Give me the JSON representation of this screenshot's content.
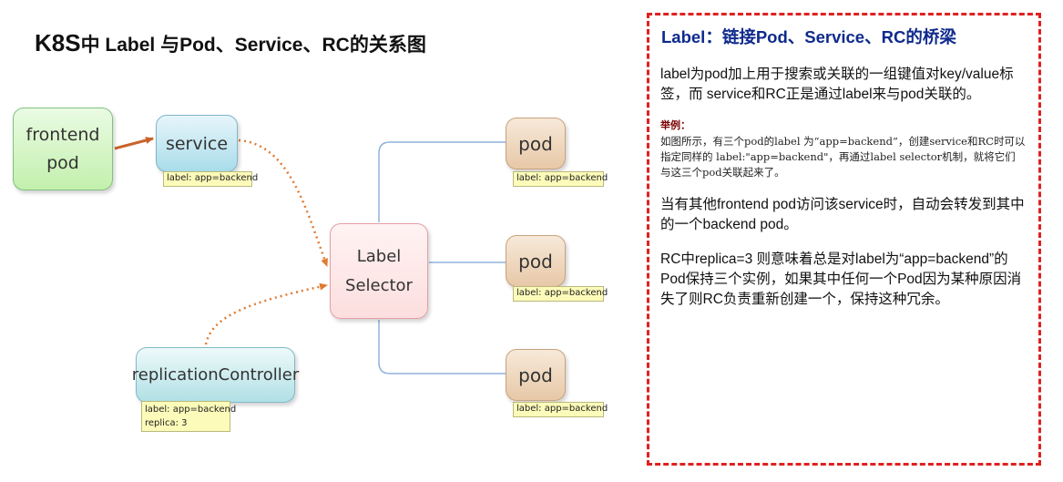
{
  "title": {
    "prefix": "K8S",
    "rest": "中 Label 与Pod、Service、RC的关系图"
  },
  "diagram": {
    "frontend": {
      "line1": "frontend",
      "line2": "pod"
    },
    "service": {
      "label": "service",
      "tag": "label: app=backend"
    },
    "selector": {
      "line1": "Label",
      "line2": "Selector"
    },
    "rc": {
      "label": "replicationController",
      "tag_line1": "label: app=backend",
      "tag_line2": "replica: 3"
    },
    "pods": [
      {
        "label": "pod",
        "tag": "label: app=backend"
      },
      {
        "label": "pod",
        "tag": "label: app=backend"
      },
      {
        "label": "pod",
        "tag": "label: app=backend"
      }
    ],
    "colors": {
      "solid_arrow": "#c8632b",
      "dotted_arrow": "#e07b32",
      "pod_lines": "#8fb2dc"
    }
  },
  "panel": {
    "title": "Label：链接Pod、Service、RC的桥梁",
    "para1": "label为pod加上用于搜索或关联的一组键值对key/value标签，而 service和RC正是通过label来与pod关联的。",
    "example_heading": "举例：",
    "example_body": "如图所示，有三个pod的label 为“app=backend”，创建service和RC时可以指定同样的 label:\"app=backend\"，再通过label selector机制，就将它们与这三个pod关联起来了。",
    "para2": "当有其他frontend pod访问该service时，自动会转发到其中的一个backend pod。",
    "para3": "RC中replica=3 则意味着总是对label为“app=backend”的Pod保持三个实例，如果其中任何一个Pod因为某种原因消失了则RC负责重新创建一个，保持这种冗余。"
  }
}
